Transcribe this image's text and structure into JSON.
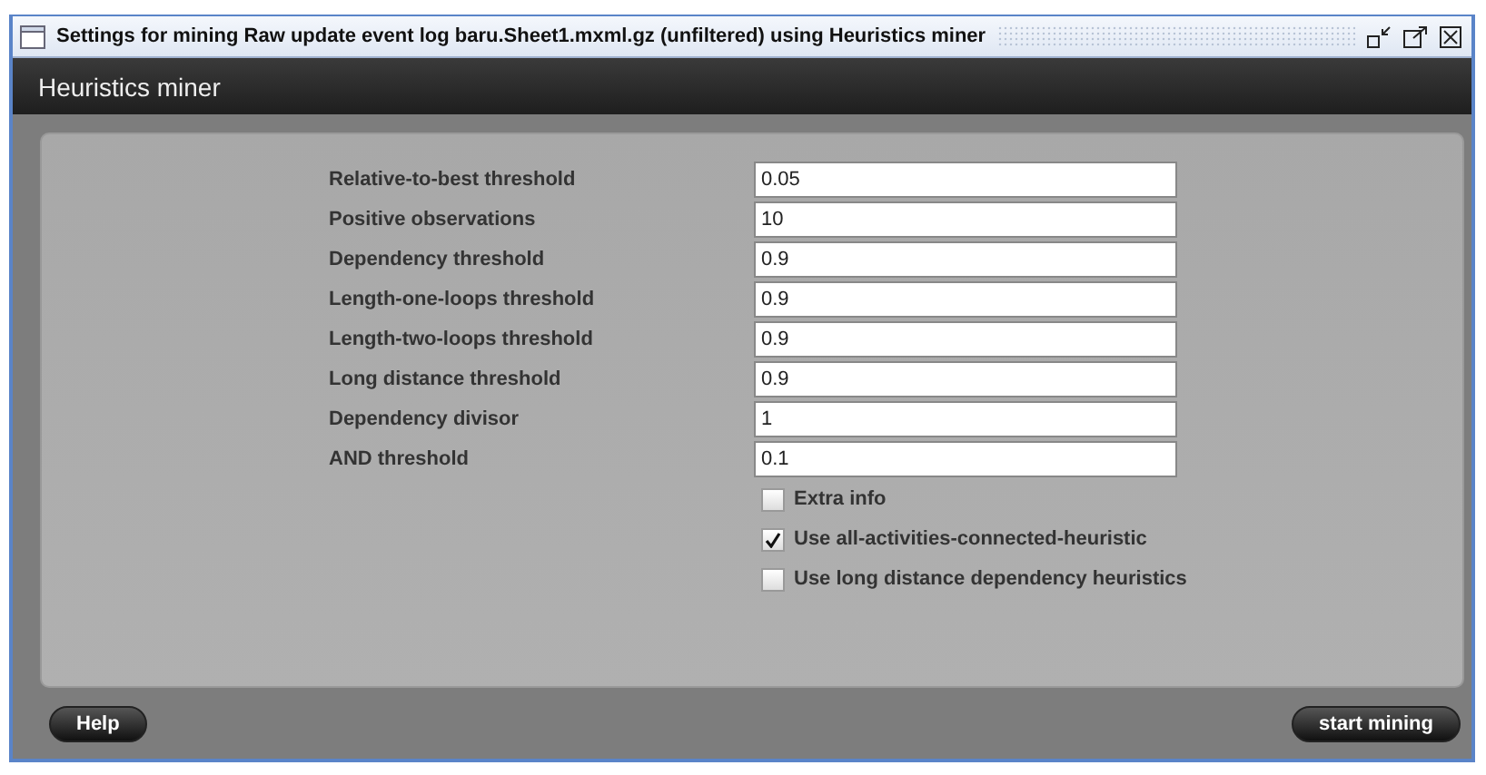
{
  "window": {
    "title": "Settings for mining Raw update event log baru.Sheet1.mxml.gz (unfiltered) using Heuristics miner"
  },
  "header": {
    "title": "Heuristics miner"
  },
  "parameters": [
    {
      "label": "Relative-to-best threshold",
      "value": "0.05"
    },
    {
      "label": "Positive observations",
      "value": "10"
    },
    {
      "label": "Dependency threshold",
      "value": "0.9"
    },
    {
      "label": "Length-one-loops threshold",
      "value": "0.9"
    },
    {
      "label": "Length-two-loops threshold",
      "value": "0.9"
    },
    {
      "label": "Long distance threshold",
      "value": "0.9"
    },
    {
      "label": "Dependency divisor",
      "value": "1"
    },
    {
      "label": "AND threshold",
      "value": "0.1"
    }
  ],
  "options": [
    {
      "label": "Extra info",
      "checked": false
    },
    {
      "label": "Use all-activities-connected-heuristic",
      "checked": true
    },
    {
      "label": "Use long distance dependency heuristics",
      "checked": false
    }
  ],
  "buttons": {
    "left": "Help",
    "right": "start mining"
  }
}
